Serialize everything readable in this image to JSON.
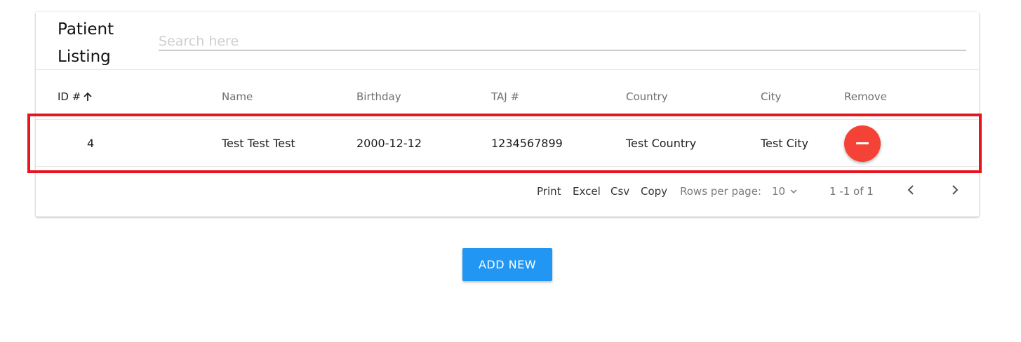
{
  "header": {
    "title": "Patient Listing",
    "search_placeholder": "Search here"
  },
  "table": {
    "columns": [
      "ID #",
      "Name",
      "Birthday",
      "TAJ #",
      "Country",
      "City",
      "Remove"
    ],
    "sort": {
      "column": "ID #",
      "direction": "ascending",
      "icon": "arrow-up-icon"
    },
    "rows": [
      {
        "id": "4",
        "name": "Test Test Test",
        "birthday": "2000-12-12",
        "taj": "1234567899",
        "country": "Test Country",
        "city": "Test City",
        "remove_icon": "minus-icon"
      }
    ]
  },
  "footer": {
    "print": "Print",
    "excel": "Excel",
    "csv": "Csv",
    "copy": "Copy",
    "rows_per_page_label": "Rows per page:",
    "rows_per_page_value": "10",
    "range": "1 -1 of 1",
    "prev_icon": "chevron-left-icon",
    "next_icon": "chevron-right-icon"
  },
  "actions": {
    "add_new": "ADD NEW"
  },
  "colors": {
    "remove_button": "#f44336",
    "add_button": "#2196f3",
    "highlight_border": "#e8141e"
  }
}
